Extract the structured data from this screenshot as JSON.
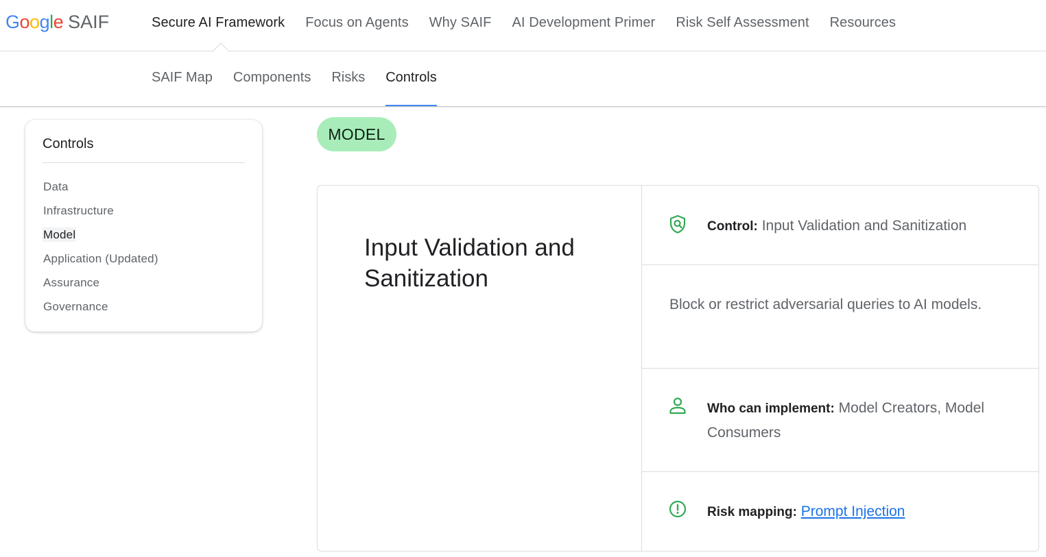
{
  "logo": {
    "brand": "Google",
    "product": "SAIF"
  },
  "top_nav": [
    {
      "label": "Secure AI Framework",
      "active": true
    },
    {
      "label": "Focus on Agents",
      "active": false
    },
    {
      "label": "Why SAIF",
      "active": false
    },
    {
      "label": "AI Development Primer",
      "active": false
    },
    {
      "label": "Risk Self Assessment",
      "active": false
    },
    {
      "label": "Resources",
      "active": false
    }
  ],
  "sub_nav": [
    {
      "label": "SAIF Map",
      "active": false
    },
    {
      "label": "Components",
      "active": false
    },
    {
      "label": "Risks",
      "active": false
    },
    {
      "label": "Controls",
      "active": true
    }
  ],
  "sidebar": {
    "title": "Controls",
    "items": [
      {
        "label": "Data",
        "active": false
      },
      {
        "label": "Infrastructure",
        "active": false
      },
      {
        "label": "Model",
        "active": true
      },
      {
        "label": "Application (Updated)",
        "active": false
      },
      {
        "label": "Assurance",
        "active": false
      },
      {
        "label": "Governance",
        "active": false
      }
    ]
  },
  "category_badge": "MODEL",
  "card": {
    "title": "Input Validation and Sanitization",
    "control_label": "Control:",
    "control_value": "Input Validation and Sanitization",
    "description": "Block or restrict adversarial queries to AI models.",
    "implementers_label": "Who can implement:",
    "implementers_value": "Model Creators, Model Consumers",
    "risk_label": "Risk mapping:",
    "risk_link": "Prompt Injection"
  },
  "colors": {
    "accent_blue": "#4285f4",
    "badge_green": "#a8edb9",
    "icon_green": "#34a853",
    "link_blue": "#1a73e8"
  },
  "icons": [
    "shield-search-icon",
    "person-icon",
    "alert-circle-icon"
  ]
}
